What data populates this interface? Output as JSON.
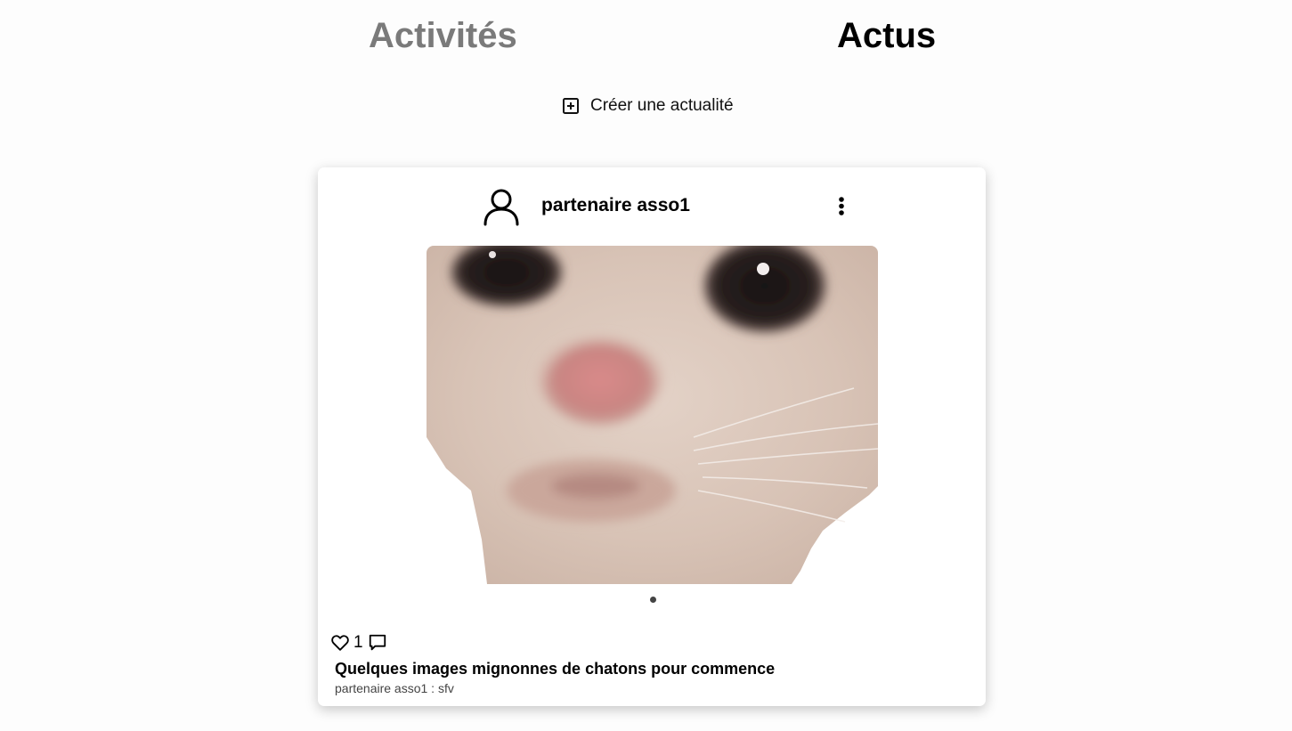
{
  "tabs": {
    "activites": "Activités",
    "actus": "Actus"
  },
  "create": {
    "icon": "plus-square-icon",
    "label": "Créer une actualité"
  },
  "post": {
    "author": "partenaire asso1",
    "author_icon": "user-icon",
    "menu_icon": "more-vertical-icon",
    "image_subject": "close-up photo of a white kitten",
    "likes": "1",
    "title": "Quelques images mignonnes de chatons pour commence",
    "subtitle": "partenaire asso1 : sfv"
  },
  "colors": {
    "active_tab": "#000000",
    "inactive_tab": "#7a7a7a",
    "background": "#fdfdfd",
    "card": "#ffffff"
  }
}
